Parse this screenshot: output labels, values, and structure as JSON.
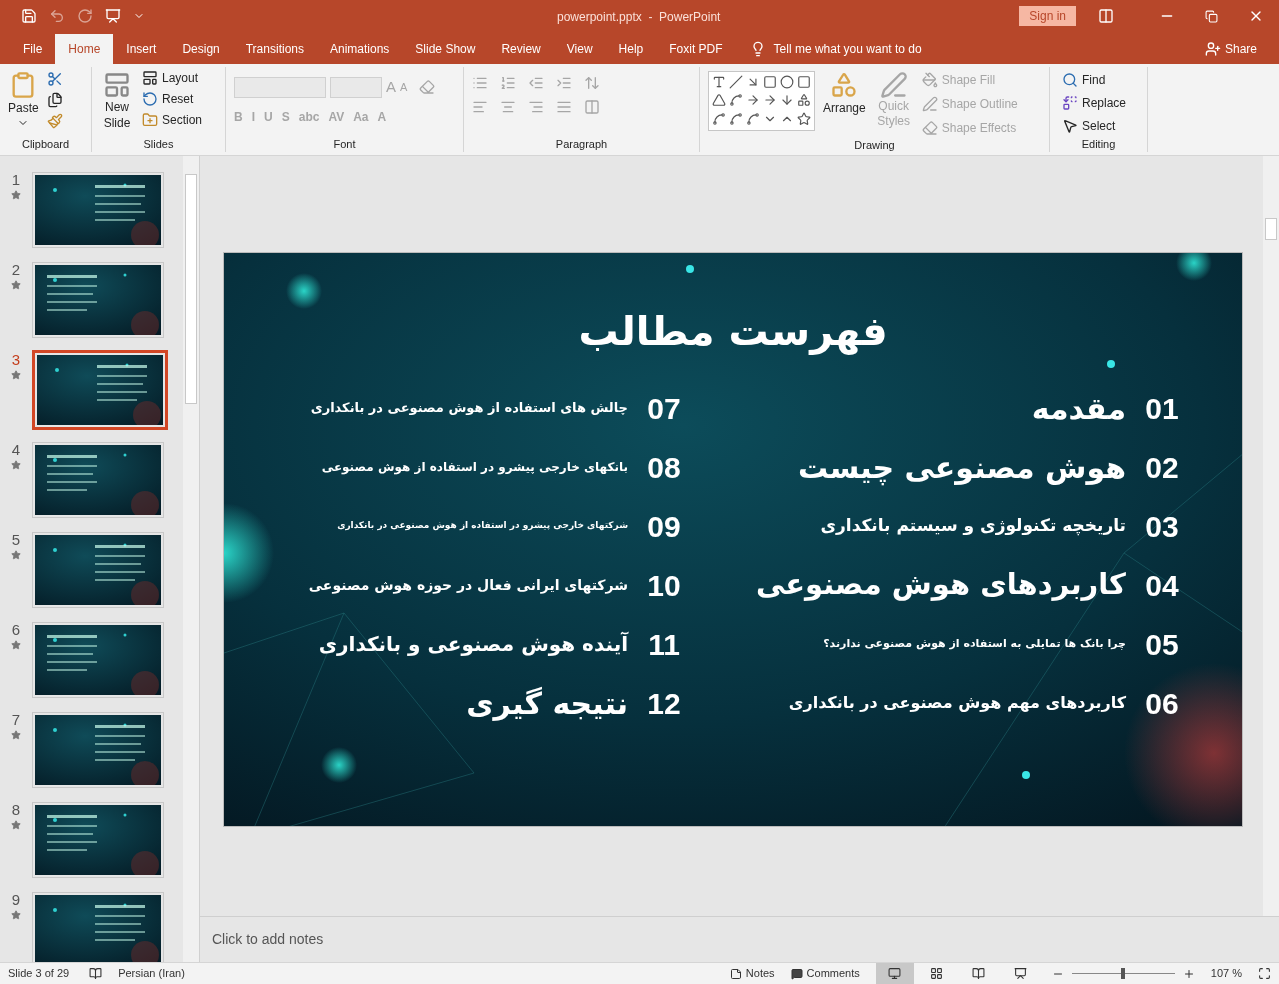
{
  "window": {
    "title": "powerpoint.pptx  -  PowerPoint",
    "sign_in": "Sign in"
  },
  "tabs": [
    {
      "label": "File",
      "selected": false
    },
    {
      "label": "Home",
      "selected": true
    },
    {
      "label": "Insert",
      "selected": false
    },
    {
      "label": "Design",
      "selected": false
    },
    {
      "label": "Transitions",
      "selected": false
    },
    {
      "label": "Animations",
      "selected": false
    },
    {
      "label": "Slide Show",
      "selected": false
    },
    {
      "label": "Review",
      "selected": false
    },
    {
      "label": "View",
      "selected": false
    },
    {
      "label": "Help",
      "selected": false
    },
    {
      "label": "Foxit PDF",
      "selected": false
    }
  ],
  "tell_me": "Tell me what you want to do",
  "share": "Share",
  "clipboard": {
    "label": "Clipboard",
    "paste": "Paste"
  },
  "slides_group": {
    "label": "Slides",
    "new_slide": "New Slide",
    "layout": "Layout",
    "reset": "Reset",
    "section": "Section"
  },
  "font": {
    "label": "Font",
    "disabled": true,
    "size_buttons": [
      "A",
      "A"
    ],
    "format_buttons": [
      "B",
      "I",
      "U",
      "S",
      "abc",
      "AV",
      "Aa",
      "A"
    ]
  },
  "paragraph": {
    "label": "Paragraph",
    "disabled": true
  },
  "drawing": {
    "label": "Drawing",
    "arrange": "Arrange",
    "quick_styles": "Quick Styles",
    "shape_fill": "Shape Fill",
    "shape_outline": "Shape Outline",
    "shape_effects": "Shape Effects",
    "disabled": true
  },
  "editing": {
    "label": "Editing",
    "find": "Find",
    "replace": "Replace",
    "select": "Select"
  },
  "thumbnails": [
    {
      "number": "1",
      "selected": false
    },
    {
      "number": "2",
      "selected": false
    },
    {
      "number": "3",
      "selected": true
    },
    {
      "number": "4",
      "selected": false
    },
    {
      "number": "5",
      "selected": false
    },
    {
      "number": "6",
      "selected": false
    },
    {
      "number": "7",
      "selected": false
    },
    {
      "number": "8",
      "selected": false
    },
    {
      "number": "9",
      "selected": false
    }
  ],
  "slide": {
    "title": "فهرست مطالب",
    "columns": [
      {
        "items": [
          {
            "number": "01",
            "text": "مقدمه"
          },
          {
            "number": "02",
            "text": "هوش مصنوعی چیست"
          },
          {
            "number": "03",
            "text": "تاریخچه تکنولوژی و سیستم بانکداری"
          },
          {
            "number": "04",
            "text": "کاربردهای هوش مصنوعی"
          },
          {
            "number": "05",
            "text": "چرا بانک ها تمایلی به استفاده از هوش مصنوعی ندارند؟"
          },
          {
            "number": "06",
            "text": "کاربردهای مهم هوش مصنوعی در بانکداری"
          }
        ]
      },
      {
        "items": [
          {
            "number": "07",
            "text": "چالش های استفاده از هوش مصنوعی در بانکداری"
          },
          {
            "number": "08",
            "text": "بانکهای خارجی پیشرو در استفاده از هوش مصنوعی"
          },
          {
            "number": "09",
            "text": "شرکتهای خارجی پیشرو در استفاده از هوش مصنوعی در بانکداری"
          },
          {
            "number": "10",
            "text": "شرکتهای ایرانی فعال در حوزه هوش مصنوعی"
          },
          {
            "number": "11",
            "text": "آینده هوش مصنوعی و بانکداری"
          },
          {
            "number": "12",
            "text": "نتیجه گیری"
          }
        ]
      }
    ]
  },
  "notes": {
    "placeholder": "Click to add notes"
  },
  "status_bar": {
    "slide_info": "Slide 3 of 29",
    "language": "Persian (Iran)",
    "notes": "Notes",
    "comments": "Comments",
    "zoom": "107 %",
    "zoom_level": {
      "level": 0.5
    },
    "views": [
      {
        "selected": true
      },
      {
        "selected": false
      },
      {
        "selected": false
      },
      {
        "selected": false
      }
    ]
  }
}
